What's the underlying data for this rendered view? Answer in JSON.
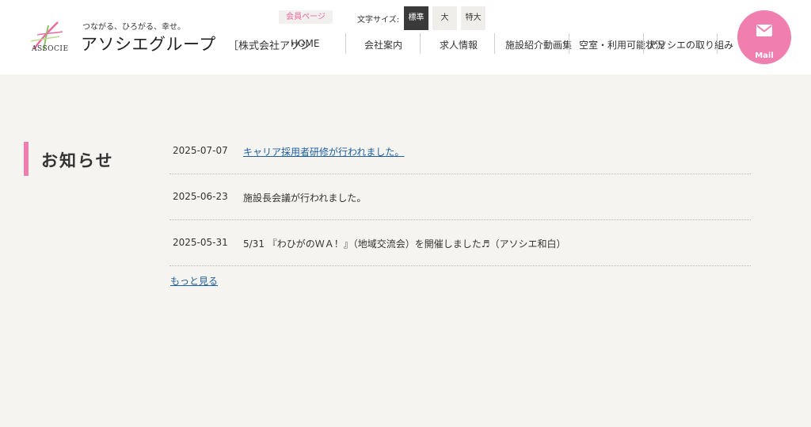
{
  "header": {
    "logo_sub": "ASSOCIE",
    "tagline": "つながる、ひろがる、幸せ。",
    "brand": "アソシエグループ",
    "corp": "［株式会社アソシ",
    "member_page": "会員ページ",
    "font_size_label": "文字サイズ:",
    "font_sizes": [
      "標準",
      "大",
      "特大"
    ],
    "nav": [
      "HOME",
      "会社案内",
      "求人情報",
      "施設紹介",
      "動画集",
      "空室・利用可能状況",
      "アソシエの取り組み"
    ],
    "mail_label": "Mail"
  },
  "section": {
    "title": "お知らせ"
  },
  "news": [
    {
      "date": "2025-07-07",
      "text": "キャリア採用者研修が行われました。"
    },
    {
      "date": "2025-06-23",
      "text": "施設長会議が行われました。"
    },
    {
      "date": "2025-05-31",
      "text": "5/31 『わひがのＷＡ！』（地域交流会）を開催しました♬（アソシエ和白）"
    }
  ],
  "more": "もっと見る",
  "colors": {
    "accent": "#ee7eb0",
    "link": "#1f5f9e",
    "background": "#f5f4f0"
  }
}
